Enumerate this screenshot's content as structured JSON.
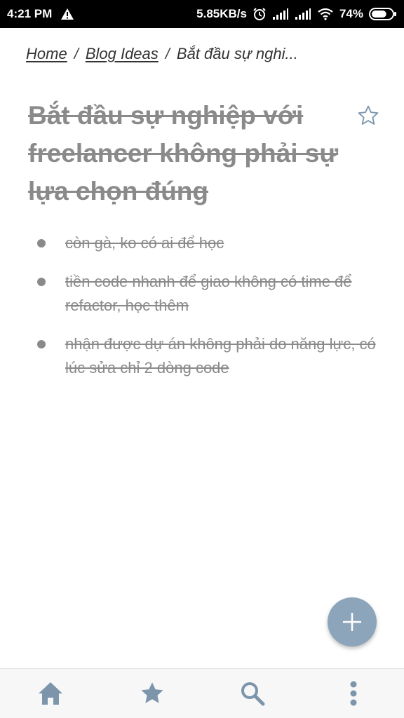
{
  "status_bar": {
    "time": "4:21 PM",
    "network_speed": "5.85KB/s",
    "battery_percent": "74%",
    "battery_level": 0.74,
    "icons": [
      "warning-icon",
      "alarm-icon",
      "signal-icon",
      "signal-icon",
      "wifi-icon",
      "battery-icon"
    ]
  },
  "breadcrumb": {
    "home": "Home",
    "parent": "Blog Ideas",
    "current": "Bắt đầu sự nghi...",
    "separator": "/"
  },
  "note": {
    "title": "Bắt đầu sự nghiệp với freelancer không phải sự lựa chọn đúng",
    "bullets": [
      "còn gà, ko có ai để học",
      "tiền code nhanh để giao không có time để refactor, học thêm",
      "nhận được dự án không phải do năng lực, có lúc sửa chỉ 2 dòng code"
    ]
  },
  "colors": {
    "accent": "#8da5ba",
    "nav_icon": "#7d95ab",
    "done_text": "#8a8a8a",
    "status_bar_bg": "#000000"
  },
  "bottom_nav": {
    "icons": [
      "home-icon",
      "star-icon",
      "search-icon",
      "more-vertical-icon"
    ]
  }
}
